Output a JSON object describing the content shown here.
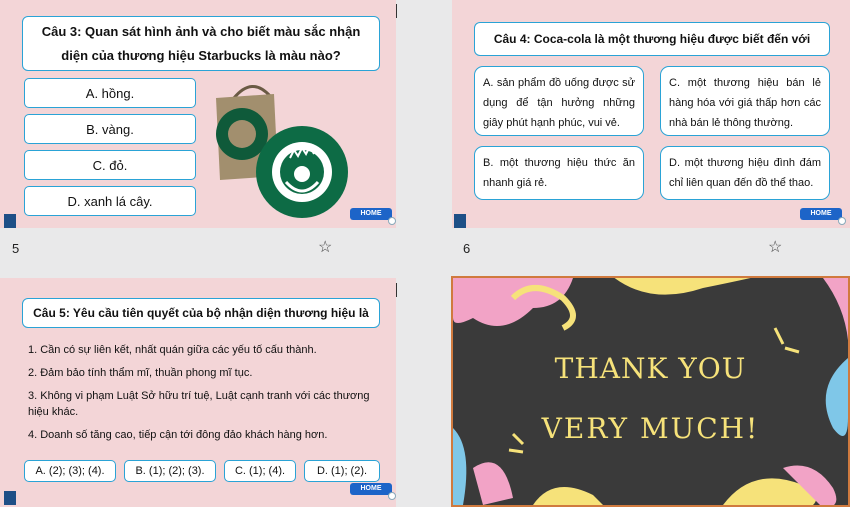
{
  "slide5": {
    "number": "5",
    "question": "Câu 3: Quan sát hình ảnh và cho biết màu sắc nhận diện của thương hiệu Starbucks là màu nào?",
    "options": [
      "A. hồng.",
      "B. vàng.",
      "C. đỏ.",
      "D. xanh lá cây."
    ],
    "home": "HOME"
  },
  "slide6": {
    "number": "6",
    "question": "Câu 4: Coca-cola là một thương hiệu được biết đến với",
    "options": [
      "A. sản phẩm đồ uống được sử dụng để tận hưởng những giây phút hạnh phúc, vui vẻ.",
      "C. một thương hiệu bán lẻ hàng hóa với giá thấp hơn các nhà bán lẻ thông thường.",
      "B. một thương hiệu thức ăn nhanh giá rẻ.",
      "D. một thương hiệu đình đám chỉ liên quan đến đồ thể thao."
    ],
    "home": "HOME"
  },
  "slide7": {
    "question": "Câu 5: Yêu cầu tiên quyết của bộ nhận diện thương hiệu là",
    "items": [
      "1. Cần có sự liên kết, nhất quán giữa các yếu tố cấu thành.",
      "2. Đảm bảo tính thẩm mĩ, thuần phong mĩ tục.",
      "3. Không vi phạm Luật Sở hữu trí tuệ, Luật cạnh tranh với các thương hiệu khác.",
      "4. Doanh số tăng cao, tiếp cận tới đông đảo khách hàng hơn."
    ],
    "options": [
      "A. (2); (3); (4).",
      "B. (1); (2); (3).",
      "C. (1); (4).",
      "D. (1); (2)."
    ],
    "home": "HOME"
  },
  "slide8": {
    "line1": "THANK YOU",
    "line2": "VERY MUCH!"
  }
}
